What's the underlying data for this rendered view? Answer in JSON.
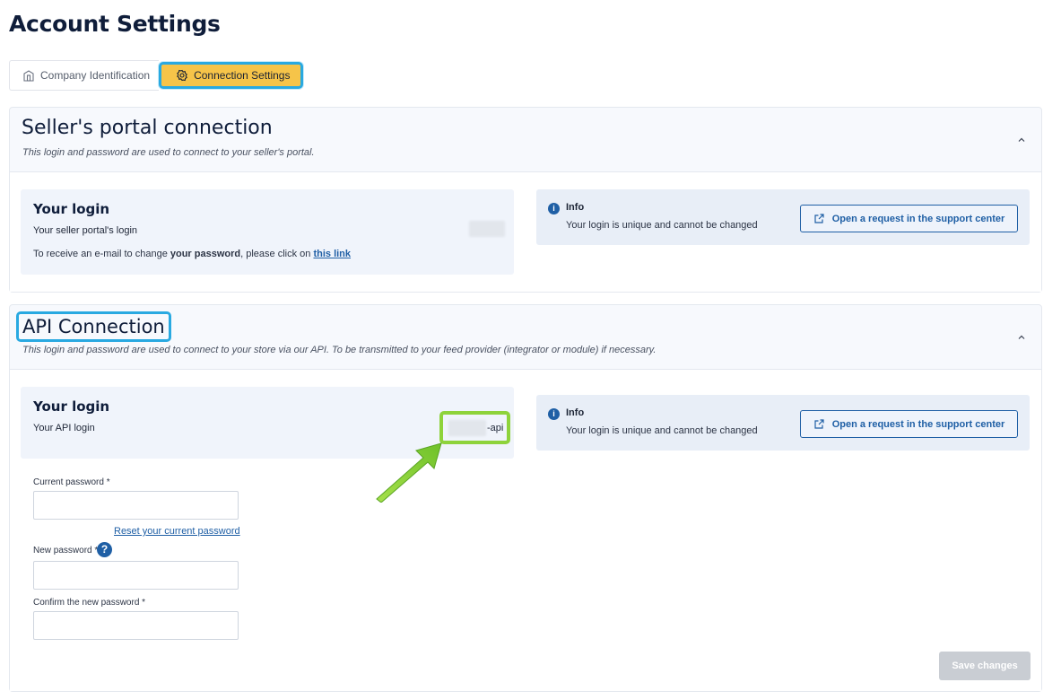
{
  "page": {
    "title": "Account Settings"
  },
  "tabs": [
    {
      "label": "Company Identification",
      "icon": "building-icon",
      "active": false
    },
    {
      "label": "Connection Settings",
      "icon": "gear-icon",
      "active": true
    }
  ],
  "sellers_portal": {
    "title": "Seller's portal connection",
    "subtitle": "This login and password are used to connect to your seller's portal.",
    "login": {
      "title": "Your login",
      "label": "Your seller portal's login",
      "note_prefix": "To receive an e-mail to change ",
      "note_bold": "your password",
      "note_mid": ", please click on ",
      "note_link": "this link"
    },
    "info": {
      "title": "Info",
      "text": "Your login is unique and cannot be changed",
      "button": "Open a request in the support center"
    }
  },
  "api_connection": {
    "title": "API Connection",
    "subtitle": "This login and password are used to connect to your store via our API. To be transmitted to your feed provider (integrator or module) if necessary.",
    "login": {
      "title": "Your login",
      "label": "Your API login",
      "value_suffix": "-api"
    },
    "info": {
      "title": "Info",
      "text": "Your login is unique and cannot be changed",
      "button": "Open a request in the support center"
    },
    "form": {
      "current_password_label": "Current password *",
      "reset_link": "Reset your current password",
      "new_password_label": "New password *",
      "confirm_password_label": "Confirm the new password *",
      "save_button": "Save changes"
    }
  },
  "colors": {
    "highlight_blue": "#29a9e1",
    "highlight_green": "#8ed33b",
    "active_tab": "#f6c449",
    "link": "#1f5fa5"
  }
}
